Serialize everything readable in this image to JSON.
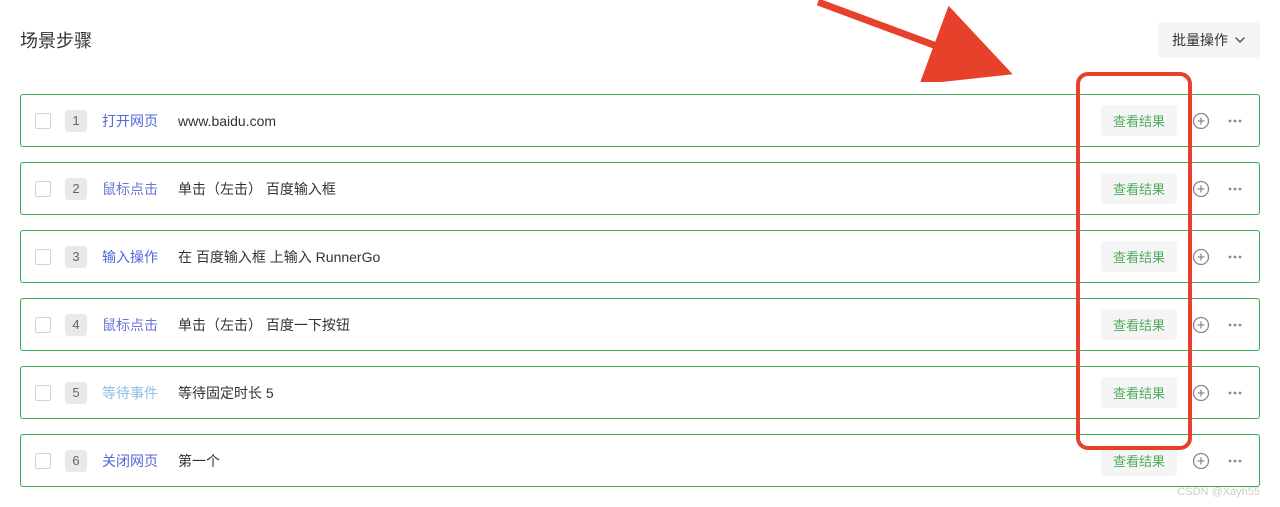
{
  "header": {
    "title": "场景步骤",
    "bulk_button": "批量操作"
  },
  "view_result_label": "查看结果",
  "steps": [
    {
      "num": "1",
      "type": "打开网页",
      "typeClass": "type-blue",
      "desc": "www.baidu.com"
    },
    {
      "num": "2",
      "type": "鼠标点击",
      "typeClass": "type-blueish",
      "desc": "单击（左击） 百度输入框"
    },
    {
      "num": "3",
      "type": "输入操作",
      "typeClass": "type-blue",
      "desc": "在 百度输入框 上输入 RunnerGo"
    },
    {
      "num": "4",
      "type": "鼠标点击",
      "typeClass": "type-blueish",
      "desc": "单击（左击） 百度一下按钮"
    },
    {
      "num": "5",
      "type": "等待事件",
      "typeClass": "type-light",
      "desc": "等待固定时长 5"
    },
    {
      "num": "6",
      "type": "关闭网页",
      "typeClass": "type-blue",
      "desc": "第一个"
    }
  ],
  "watermark": "CSDN @Xayh55"
}
